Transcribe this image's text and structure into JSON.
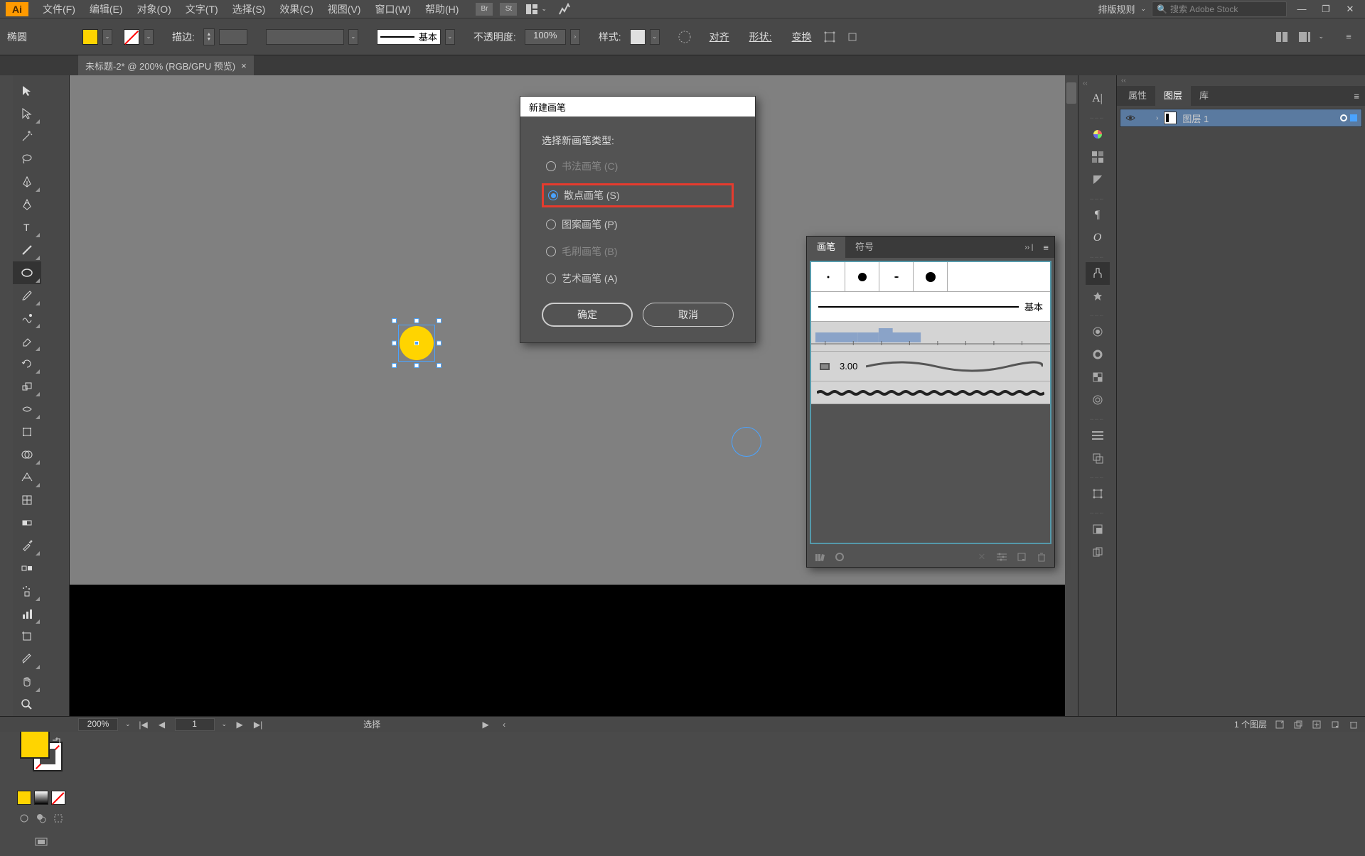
{
  "menubar": {
    "logo": "Ai",
    "items": [
      "文件(F)",
      "编辑(E)",
      "对象(O)",
      "文字(T)",
      "选择(S)",
      "效果(C)",
      "视图(V)",
      "窗口(W)",
      "帮助(H)"
    ],
    "typeset_label": "排版规则",
    "search_placeholder": "搜索 Adobe Stock"
  },
  "controlbar": {
    "shape_label": "椭圆",
    "stroke_label": "描边:",
    "brush_basic": "基本",
    "opacity_label": "不透明度:",
    "opacity_value": "100%",
    "style_label": "样式:",
    "align_label": "对齐",
    "shapes_label": "形状:",
    "transform_label": "变换"
  },
  "document": {
    "tab_title": "未标题-2* @ 200% (RGB/GPU 预览)"
  },
  "dialog": {
    "title": "新建画笔",
    "prompt": "选择新画笔类型:",
    "options": {
      "calligraphy": "书法画笔 (C)",
      "scatter": "散点画笔 (S)",
      "pattern": "图案画笔 (P)",
      "bristle": "毛刷画笔 (B)",
      "art": "艺术画笔 (A)"
    },
    "ok": "确定",
    "cancel": "取消"
  },
  "brush_panel": {
    "tab_brush": "画笔",
    "tab_symbol": "符号",
    "basic_label": "基本",
    "cal_size": "3.00"
  },
  "rpanel": {
    "tab_props": "属性",
    "tab_layers": "图层",
    "tab_lib": "库",
    "layer_name": "图层 1"
  },
  "status": {
    "zoom": "200%",
    "artboard": "1",
    "mode": "选择",
    "layer_count": "1 个图层"
  }
}
